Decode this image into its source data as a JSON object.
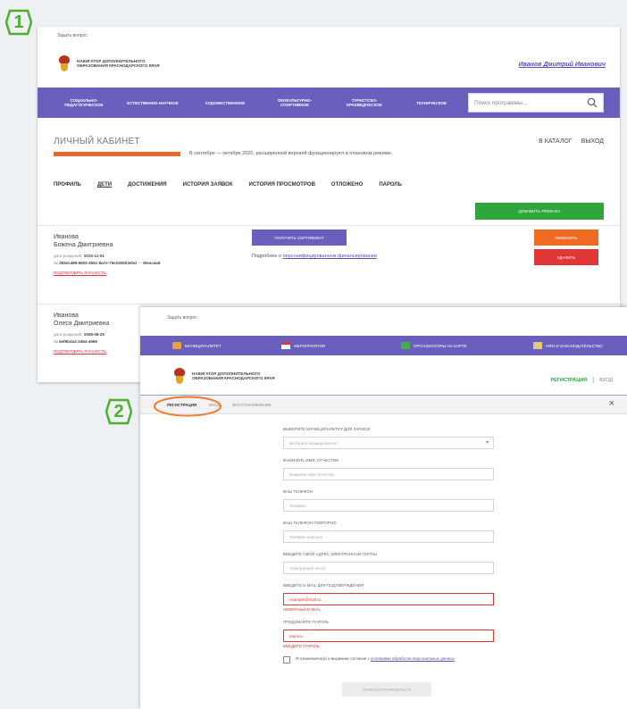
{
  "steps": {
    "one": "1",
    "two": "2"
  },
  "shot1": {
    "system_line": "Задать вопрос",
    "logo_text": "НАВИГАТОР ДОПОЛНИТЕЛЬНОГО ОБРАЗОВАНИЯ КРАСНОДАРСКОГО КРАЯ",
    "user_name": "Иванов Дмитрий Иванович",
    "nav_items": [
      "СОЦИАЛЬНО-ПЕДАГОГИЧЕСКОЕ",
      "ЕСТЕСТВЕННО-НАУЧНОЕ",
      "ХУДОЖЕСТВЕННОЕ",
      "ФИЗКУЛЬТУРНО-СПОРТИВНОЕ",
      "ТУРИСТСКО-КРАЕВЕДЧЕСКОЕ",
      "ТЕХНИЧЕСКОЕ"
    ],
    "search_placeholder": "Поиск программы...",
    "cabinet_title": "ЛИЧНЫЙ КАБИНЕТ",
    "notice": "В сентябре — октябре 2020, расширенной версией функционируют в плановом режиме.",
    "top_links": {
      "catalog": "В КАТАЛОГ",
      "exit": "ВЫХОД"
    },
    "tabs": [
      "ПРОФИЛЬ",
      "ДЕТИ",
      "ДОСТИЖЕНИЯ",
      "ИСТОРИЯ ЗАЯВОК",
      "ИСТОРИЯ ПРОСМОТРОВ",
      "ОТЛОЖЕНО",
      "ПАРОЛЬ"
    ],
    "add_child_button": "ДОБАВИТЬ РЕБЕНКА",
    "children": [
      {
        "surname": "Иванова",
        "name": "Божена Дмитриевна",
        "birth_label": "дата рождения:",
        "birth": "2015-12-01",
        "cert_prefix": "№",
        "cert": "393ec489-6903-4551-8a7e-79e2305b3ebd",
        "cert_suffix": "Женский",
        "confirm_link": "ПОДТВЕРДИТЬ ЛИЧНОСТЬ",
        "action_button": "ПОЛУЧИТЬ СЕРТИФИКАТ",
        "info_prefix": "Подробнее о",
        "info_link": "персонифицированном финансировании",
        "edit_button": "ИЗМЕНИТЬ",
        "delete_button": "УДАЛИТЬ"
      },
      {
        "surname": "Иванова",
        "name": "Олеся Дмитриевна",
        "birth_label": "дата рождения:",
        "birth": "2008-08-25",
        "cert_prefix": "№",
        "cert": "5ef9bda3-2d64-4969",
        "confirm_link": "ПОДТВЕРДИТЬ ЛИЧНОСТЬ",
        "action_button": "ПОЛУЧИТЬ СЕРТИФИКАТ",
        "edit_button": "ИЗМЕНИТЬ"
      }
    ]
  },
  "shot2": {
    "system_line": "Задать вопрос",
    "nav_items": [
      "МУНИЦИПАЛИТЕТ",
      "МЕРОПРИЯТИЯ",
      "ОРГАНИЗАТОРЫ НА КАРТЕ",
      "НФО И ЗАКОНОДАТЕЛЬСТВО"
    ],
    "logo_text": "НАВИГАТОР ДОПОЛНИТЕЛЬНОГО ОБРАЗОВАНИЯ КРАСНОДАРСКОГО КРАЯ",
    "register_link": "РЕГИСТРАЦИЯ",
    "separator": "|",
    "login_link": "ВХОД",
    "modal_tabs": [
      "РЕГИСТРАЦИЯ",
      "ВХОД",
      "ВОССТАНОВЛЕНИЕ"
    ],
    "close": "×",
    "fields": [
      {
        "label": "ВЫБЕРИТЕ МУНИЦИПАЛИТЕТ ДЛЯ ЗАПИСИ",
        "placeholder": "Выберите муниципалитет",
        "type": "select"
      },
      {
        "label": "ФАМИЛИЯ, ИМЯ, ОТЧЕСТВО",
        "placeholder": "Фамилия Имя Отчество"
      },
      {
        "label": "ВАШ ТЕЛЕФОН",
        "placeholder": "Телефон"
      },
      {
        "label": "ВАШ ТЕЛЕФОН ПОВТОРНО",
        "placeholder": "Телефон ещё раз"
      },
      {
        "label": "ВВЕДИТЕ СВОЙ АДРЕС ЭЛЕКТРОННОЙ ПОЧТЫ",
        "placeholder": "Электронная почта"
      },
      {
        "label": "ВВЕДИТЕ E-MAIL ДЛЯ ПОДТВЕРЖДЕНИЯ",
        "value": "example@mail.ru",
        "error": "НЕВЕРНЫЙ E-MAIL"
      },
      {
        "label": "ПРИДУМАЙТЕ ПАРОЛЬ",
        "value": "пароль",
        "error": "ВВЕДИТЕ ПАРОЛЬ"
      }
    ],
    "agreement_prefix": "Я ознакомлен(а) и выражаю согласие с",
    "agreement_link": "условиями обработки персональных данных",
    "submit_button": "ЗАРЕГИСТРИРОВАТЬСЯ"
  }
}
